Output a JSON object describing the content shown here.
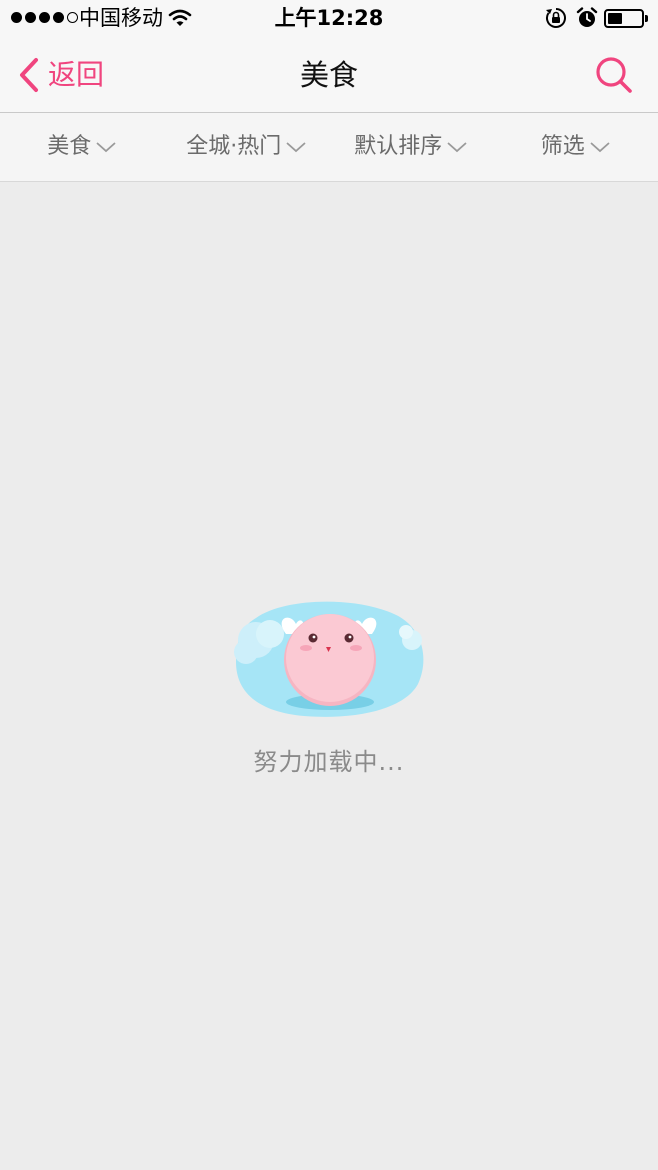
{
  "status_bar": {
    "carrier": "中国移动",
    "time": "上午12:28",
    "battery_level_percent": 45,
    "icons": [
      "signal-dots-icon",
      "wifi-icon",
      "rotation-lock-icon",
      "alarm-icon",
      "battery-icon"
    ]
  },
  "nav": {
    "back_label": "返回",
    "title": "美食",
    "accent_color": "#f0457f",
    "search_icon": "search-icon"
  },
  "filters": [
    {
      "label": "美食"
    },
    {
      "label": "全城·热门"
    },
    {
      "label": "默认排序"
    },
    {
      "label": "筛选"
    }
  ],
  "loading": {
    "text": "努力加载中...",
    "illustration": "pink-mascot-on-cloud"
  }
}
